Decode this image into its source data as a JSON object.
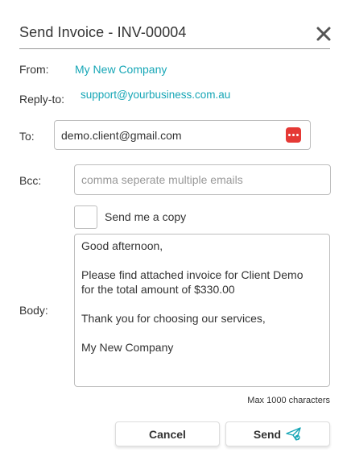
{
  "dialog": {
    "title": "Send Invoice - INV-00004",
    "close_icon": "close-icon"
  },
  "from": {
    "label": "From:",
    "value": "My New Company"
  },
  "reply_to": {
    "label": "Reply-to:",
    "value": "support@yourbusiness.com.au"
  },
  "to": {
    "label": "To:",
    "value": "demo.client@gmail.com",
    "action_icon": "more-options-icon"
  },
  "bcc": {
    "label": "Bcc:",
    "value": "",
    "placeholder": "comma seperate multiple emails"
  },
  "copy": {
    "label": "Send me a copy",
    "checked": false
  },
  "body": {
    "label": "Body:",
    "lines": [
      "Good afternoon,",
      "",
      "Please find attached invoice for Client Demo",
      "for the total amount of $330.00",
      "",
      "Thank you for choosing our services,",
      "",
      "My New Company"
    ],
    "max_note": "Max 1000 characters"
  },
  "actions": {
    "cancel_label": "Cancel",
    "send_label": "Send",
    "send_icon": "paper-plane-icon"
  },
  "colors": {
    "link": "#16a6b6",
    "danger": "#e53935",
    "border": "#bdbdbd",
    "text": "#333333"
  }
}
